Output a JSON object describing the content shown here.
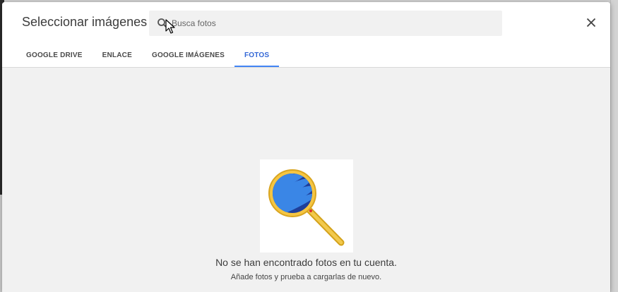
{
  "dialog": {
    "title": "Seleccionar imágenes",
    "close_icon": "close-icon"
  },
  "search": {
    "placeholder": "Busca fotos",
    "value": "",
    "icon": "search-icon"
  },
  "tabs": [
    {
      "label": "GOOGLE DRIVE",
      "active": false
    },
    {
      "label": "ENLACE",
      "active": false
    },
    {
      "label": "GOOGLE IMÁGENES",
      "active": false
    },
    {
      "label": "FOTOS",
      "active": true
    }
  ],
  "empty_state": {
    "title": "No se han encontrado fotos en tu cuenta.",
    "subtitle": "Añade fotos y prueba a cargarlas de nuevo.",
    "illustration": "magnifying-glass-globe-icon"
  },
  "colors": {
    "accent": "#4285f4",
    "content_bg": "#f1f1f1"
  }
}
